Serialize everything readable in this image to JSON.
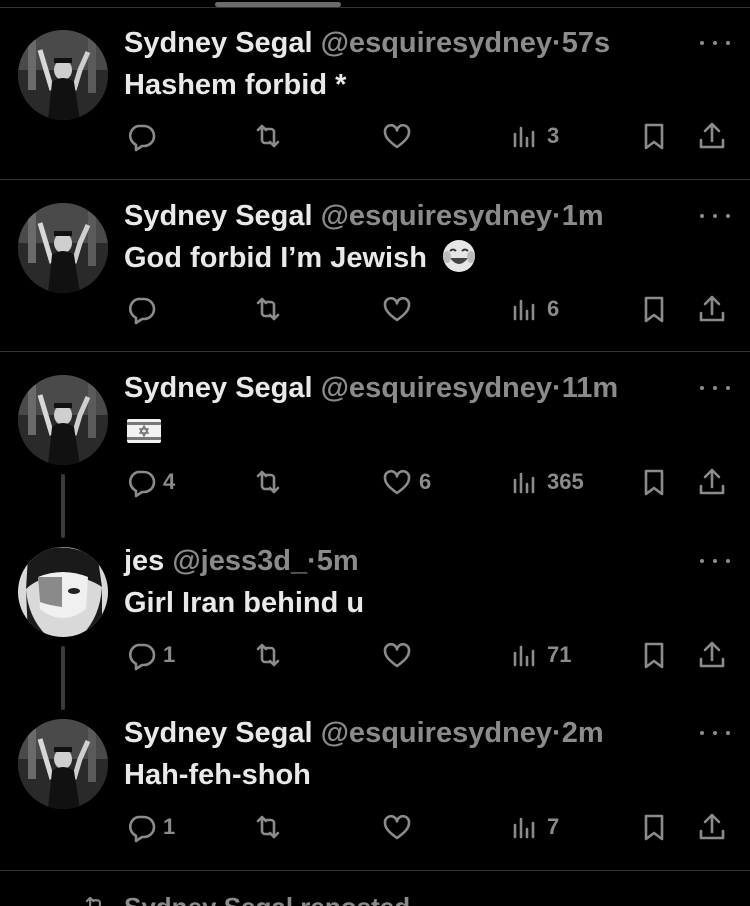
{
  "tweets": [
    {
      "name": "Sydney Segal",
      "handle": "@esquiresydney",
      "dot": "·",
      "time": "57s",
      "text": "Hashem forbid *",
      "replies": "",
      "likes": "",
      "views": "3",
      "avatar": "graduate-photo"
    },
    {
      "name": "Sydney Segal",
      "handle": "@esquiresydney",
      "dot": "·",
      "time": "1m",
      "text": "God forbid I’m Jewish",
      "emoji": "tears-of-joy-emoji",
      "replies": "",
      "likes": "",
      "views": "6",
      "avatar": "graduate-photo"
    },
    {
      "name": "Sydney Segal",
      "handle": "@esquiresydney",
      "dot": "·",
      "time": "11m",
      "text": "",
      "flag": "israel-flag-emoji",
      "replies": "4",
      "likes": "6",
      "views": "365",
      "avatar": "graduate-photo"
    },
    {
      "name": "jes",
      "handle": "@jess3d_",
      "dot": "·",
      "time": "5m",
      "text": "Girl Iran behind u",
      "replies": "1",
      "likes": "",
      "views": "71",
      "avatar": "anime-character"
    },
    {
      "name": "Sydney Segal",
      "handle": "@esquiresydney",
      "dot": "·",
      "time": "2m",
      "text": "Hah-feh-shoh",
      "replies": "1",
      "likes": "",
      "views": "7",
      "avatar": "graduate-photo"
    }
  ],
  "footer": {
    "repost_label": "Sydney Segal reposted"
  },
  "colors": {
    "background": "#000000",
    "text": "#e7e9ea",
    "muted": "#8b8b8b",
    "separator": "#2f3336"
  },
  "icons": [
    "reply-icon",
    "retweet-icon",
    "like-icon",
    "views-icon",
    "bookmark-icon",
    "share-icon",
    "more-icon"
  ]
}
